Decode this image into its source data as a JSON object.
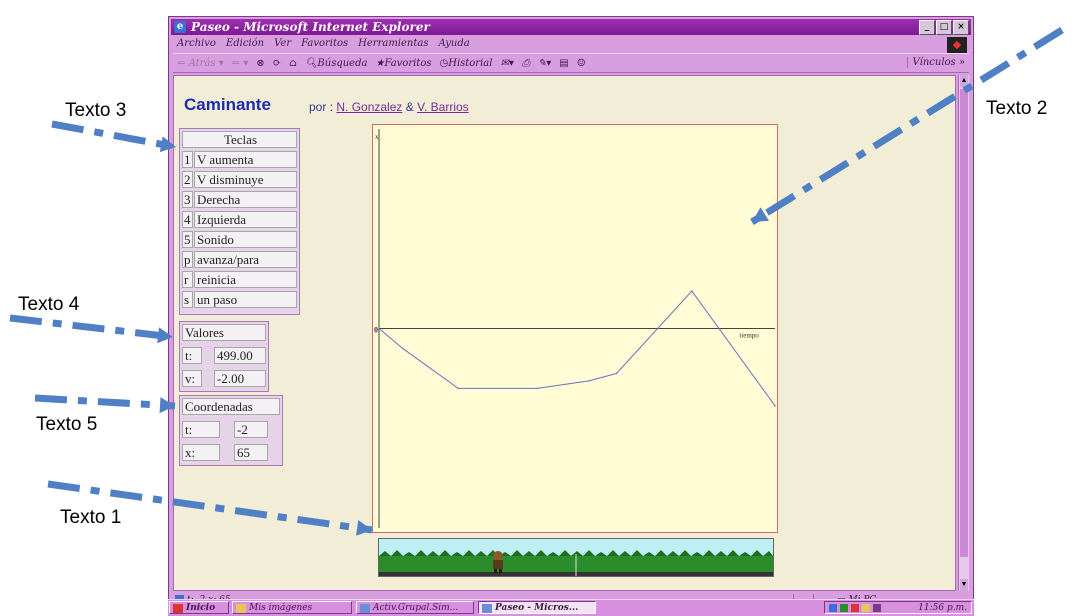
{
  "window": {
    "title": "Paseo - Microsoft Internet Explorer",
    "icon": "ie-icon"
  },
  "menu": [
    "Archivo",
    "Edición",
    "Ver",
    "Favoritos",
    "Herramientas",
    "Ayuda"
  ],
  "toolbar": {
    "atras": "Atrás",
    "busqueda": "Búsqueda",
    "favoritos": "Favoritos",
    "historial": "Historial",
    "vinculos": "Vínculos »"
  },
  "page": {
    "title": "Caminante",
    "by_prefix": "por :",
    "author1": "N. Gonzalez",
    "and": "&",
    "author2": "V. Barrios"
  },
  "teclas": {
    "header": "Teclas",
    "keys": [
      {
        "key": "1",
        "action": "V aumenta"
      },
      {
        "key": "2",
        "action": "V disminuye"
      },
      {
        "key": "3",
        "action": "Derecha"
      },
      {
        "key": "4",
        "action": "Izquierda"
      },
      {
        "key": "5",
        "action": "Sonido"
      },
      {
        "key": "p",
        "action": "avanza/para"
      },
      {
        "key": "r",
        "action": "reinicia"
      },
      {
        "key": "s",
        "action": "un paso"
      }
    ]
  },
  "valores": {
    "header": "Valores",
    "t_label": "t:",
    "t_value": "499.00",
    "v_label": "v:",
    "v_value": "-2.00"
  },
  "coordenadas": {
    "header": "Coordenadas",
    "t_label": "t:",
    "t_value": "-2",
    "x_label": "x:",
    "x_value": "65"
  },
  "chart_data": {
    "type": "line",
    "ylabel": "x",
    "xlabel": "tiempo",
    "origin_label": "0",
    "series": [
      {
        "values": [
          0,
          -8,
          -24,
          -24,
          -21,
          -18,
          15,
          -31
        ]
      }
    ],
    "x": [
      0,
      6,
      20,
      40,
      53,
      60,
      79,
      100
    ],
    "xlim": [
      0,
      100
    ],
    "ylim": [
      -80,
      80
    ],
    "line_color": "#6f6fc3",
    "axis_color": "#444444"
  },
  "status": {
    "text": "t: -2  x: 65",
    "zone": "Mi PC"
  },
  "taskbar": {
    "start": "Inicio",
    "tasks": [
      "Mis imágenes",
      "Activ.Grupal.Sim...",
      "Paseo - Micros..."
    ],
    "clock": "11:56 p.m."
  },
  "annotations": {
    "texto1": "Texto 1",
    "texto2": "Texto 2",
    "texto3": "Texto 3",
    "texto4": "Texto 4",
    "texto5": "Texto 5",
    "arrow_color": "#4f7fc4"
  }
}
